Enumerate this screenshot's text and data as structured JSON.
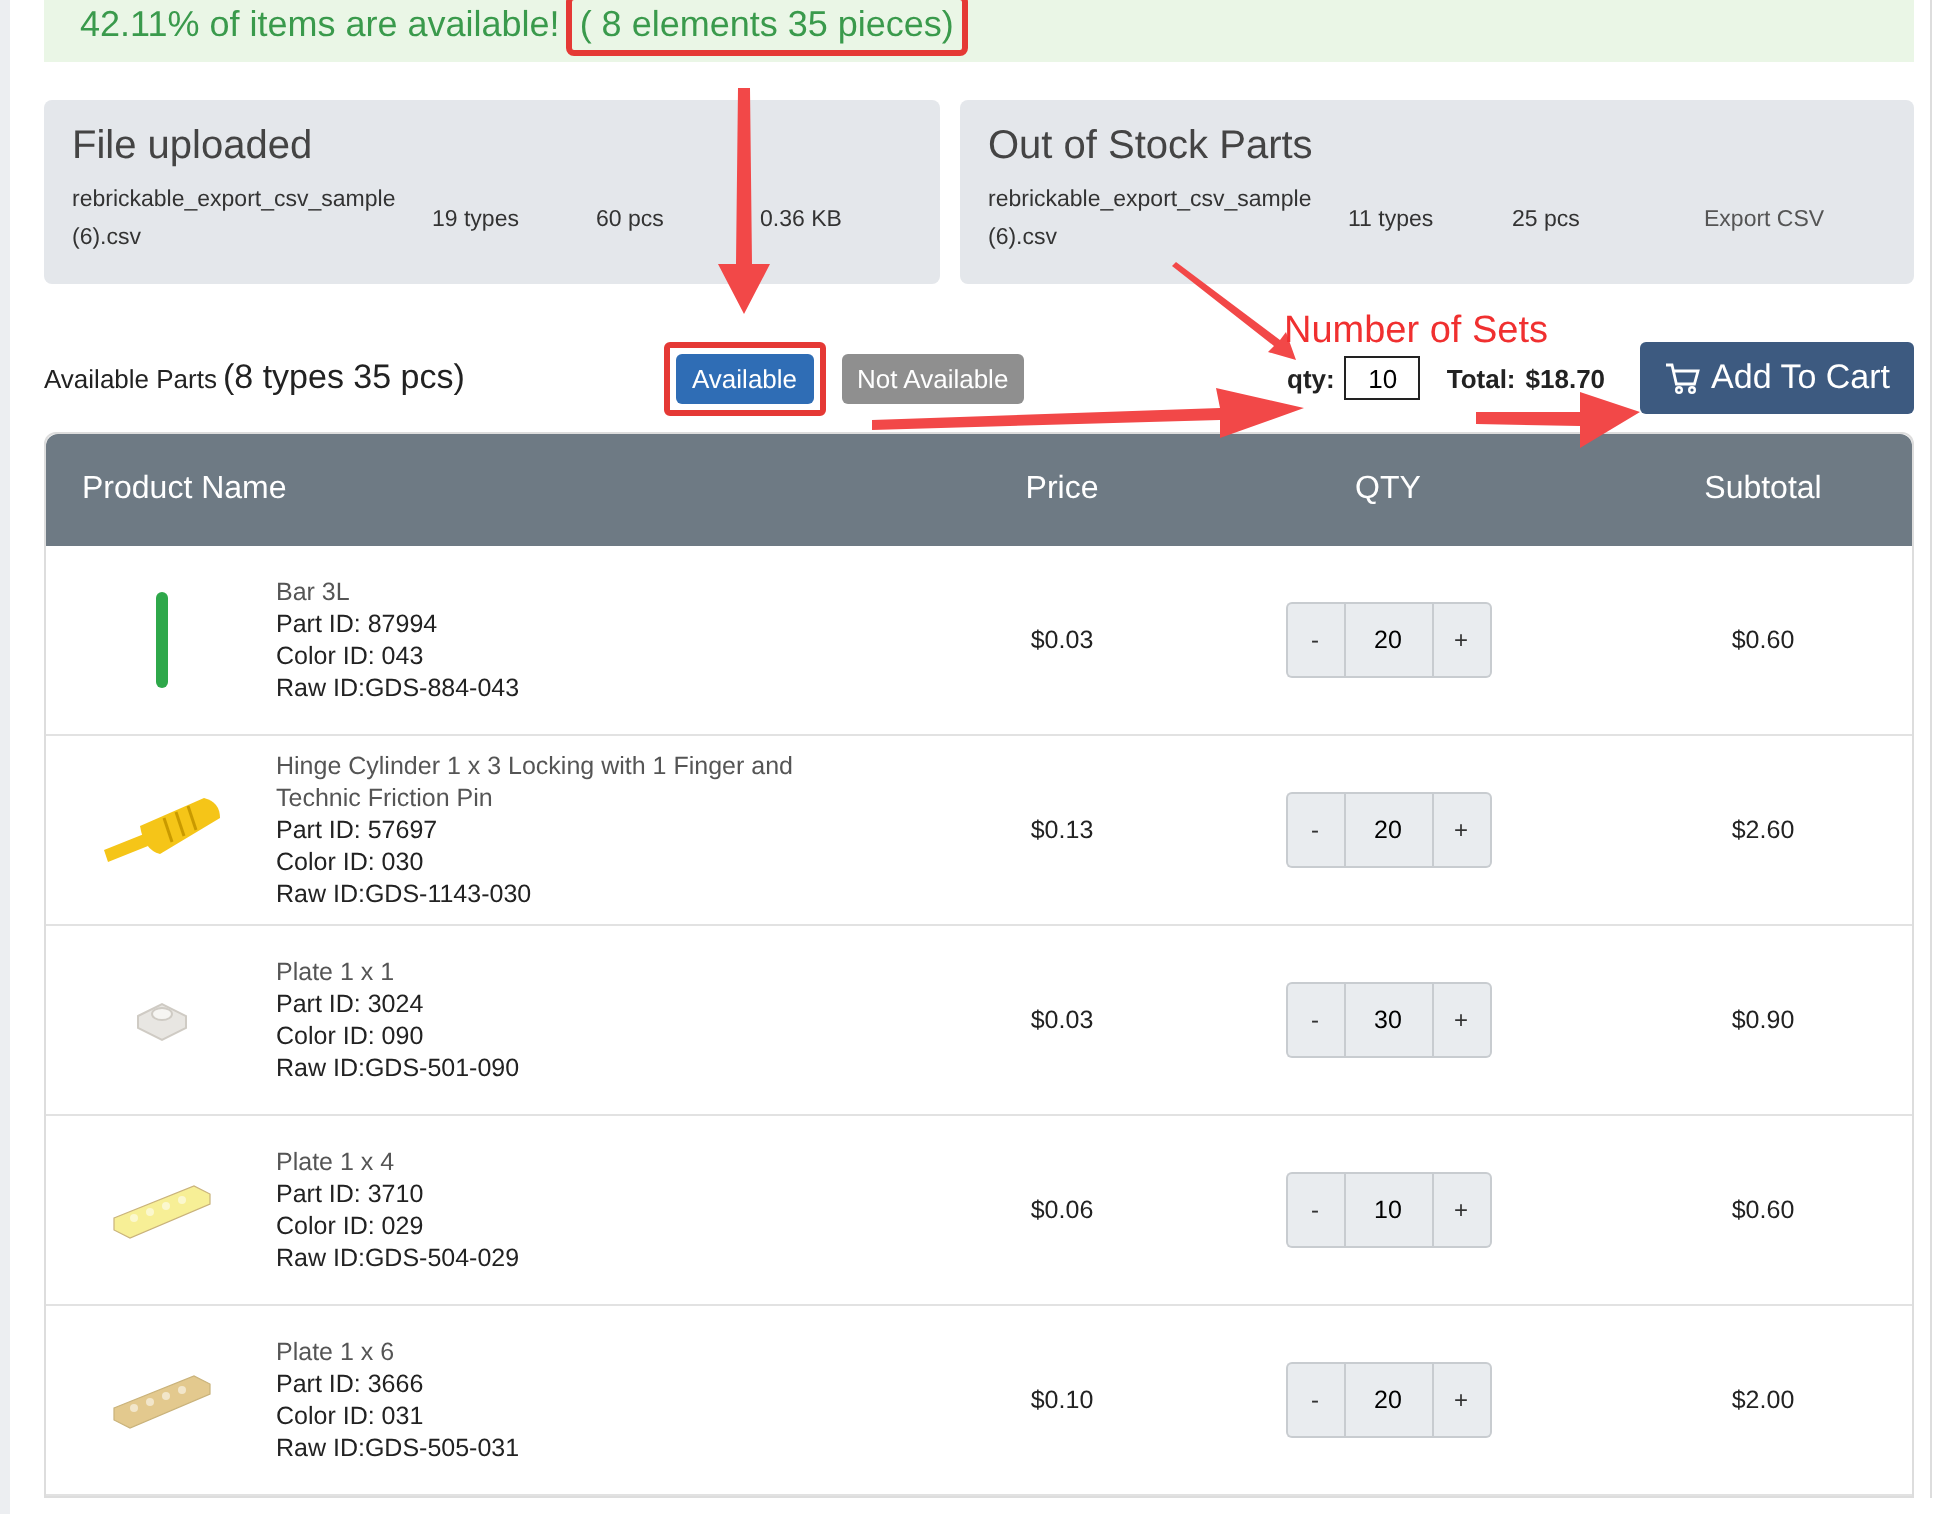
{
  "banner": {
    "message": "42.11% of items are available!",
    "count": "( 8 elements 35 pieces)",
    "count_highlighted": true
  },
  "cards": [
    {
      "title": "File uploaded",
      "file": "rebrickable_export_csv_sample (6).csv",
      "types": "19 types",
      "pcs": "60 pcs",
      "extra": "0.36 KB",
      "kind": "info"
    },
    {
      "title": "Out of Stock Parts",
      "file": "rebrickable_export_csv_sample (6).csv",
      "types": "11 types",
      "pcs": "25 pcs",
      "extra": "Export CSV",
      "kind": "link"
    }
  ],
  "toolbar": {
    "label": "Available Parts",
    "summary": "(8 types 35 pcs)",
    "filters": [
      {
        "label": "Available",
        "selected": true,
        "highlighted": true
      },
      {
        "label": "Not Available",
        "selected": false,
        "highlighted": false
      }
    ],
    "qty_label": "qty:",
    "qty_value": "10",
    "total_label": "Total:",
    "total": "$18.70",
    "add_button": "Add To Cart"
  },
  "annotation": {
    "label": "Number of Sets"
  },
  "table": {
    "columns": [
      "Product Name",
      "Price",
      "QTY",
      "Subtotal"
    ],
    "rows": [
      {
        "kind": "bar",
        "color": "#2ea84a",
        "name": "Bar 3L",
        "part_id": "Part ID: 87994",
        "color_id": "Color ID: 043",
        "raw_id": "Raw ID:GDS-884-043",
        "price": "$0.03",
        "minus": "-",
        "qty": "20",
        "plus": "+",
        "subtotal": "$0.60"
      },
      {
        "kind": "hinge",
        "color": "#f5c518",
        "name": "Hinge Cylinder 1 x 3 Locking with 1 Finger and Technic Friction Pin",
        "part_id": "Part ID: 57697",
        "color_id": "Color ID: 030",
        "raw_id": "Raw ID:GDS-1143-030",
        "price": "$0.13",
        "minus": "-",
        "qty": "20",
        "plus": "+",
        "subtotal": "$2.60"
      },
      {
        "kind": "square",
        "color": "#e8e6e2",
        "name": "Plate 1 x 1",
        "part_id": "Part ID: 3024",
        "color_id": "Color ID: 090",
        "raw_id": "Raw ID:GDS-501-090",
        "price": "$0.03",
        "minus": "-",
        "qty": "30",
        "plus": "+",
        "subtotal": "$0.90"
      },
      {
        "kind": "strip",
        "color": "#f7ef96",
        "name": "Plate 1 x 4",
        "part_id": "Part ID: 3710",
        "color_id": "Color ID: 029",
        "raw_id": "Raw ID:GDS-504-029",
        "price": "$0.06",
        "minus": "-",
        "qty": "10",
        "plus": "+",
        "subtotal": "$0.60"
      },
      {
        "kind": "strip",
        "color": "#e3c98e",
        "name": "Plate 1 x 6",
        "part_id": "Part ID: 3666",
        "color_id": "Color ID: 031",
        "raw_id": "Raw ID:GDS-505-031",
        "price": "$0.10",
        "minus": "-",
        "qty": "20",
        "plus": "+",
        "subtotal": "$2.00"
      }
    ]
  }
}
